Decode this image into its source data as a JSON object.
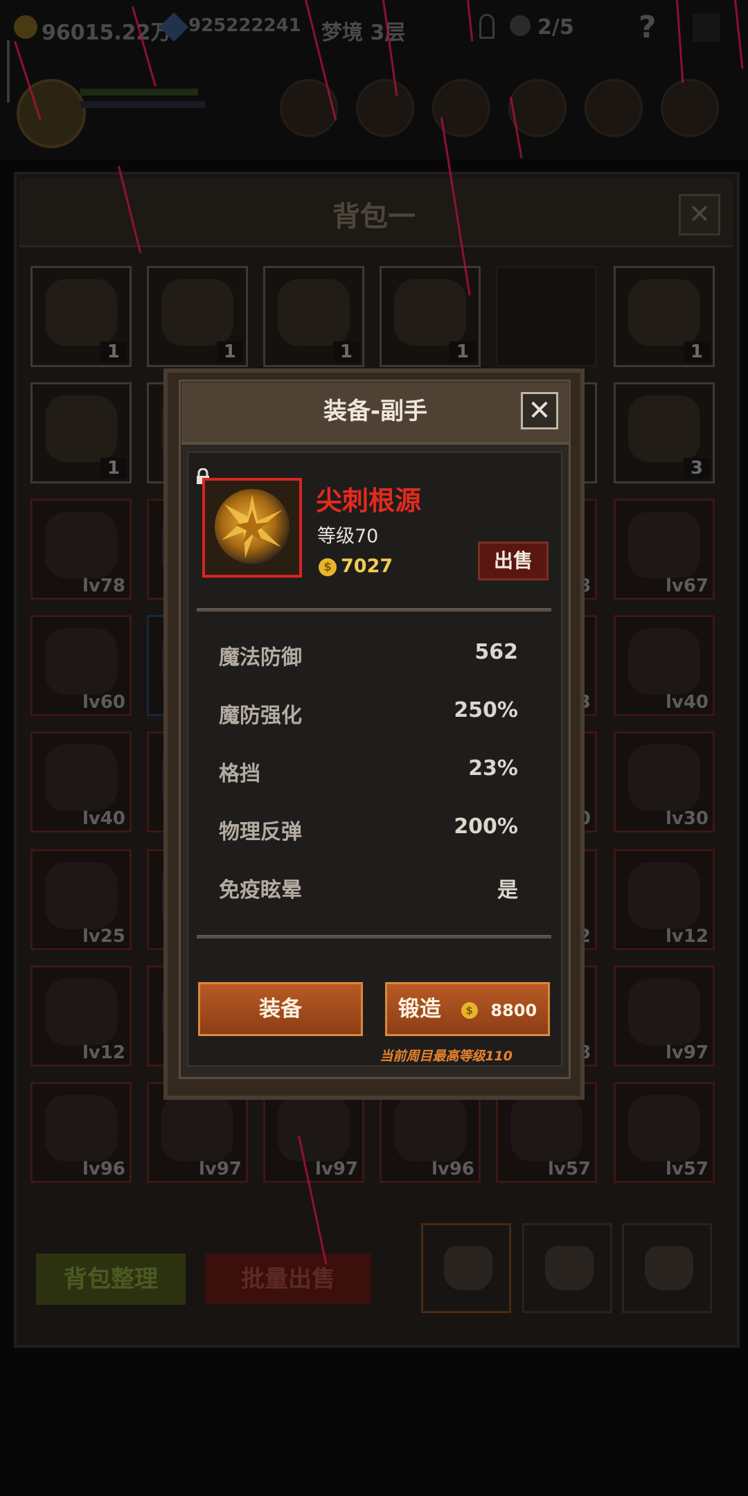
{
  "hud": {
    "gold": "96015.22万",
    "gems": "925222241",
    "dream_level": "梦境 3层",
    "key_progress": "2/5",
    "help": "?"
  },
  "bag": {
    "title": "背包一",
    "close": "✕",
    "rows": [
      [
        {
          "type": "item",
          "count": "1",
          "icon": "cake-icon"
        },
        {
          "type": "item",
          "count": "1",
          "icon": "cake-icon"
        },
        {
          "type": "item",
          "count": "1",
          "icon": "beer-mug-icon"
        },
        {
          "type": "item",
          "count": "1",
          "icon": "beer-mug-icon"
        },
        {
          "type": "empty"
        },
        {
          "type": "item",
          "count": "1",
          "icon": "cheese-icon"
        }
      ],
      [
        {
          "type": "item",
          "count": "1",
          "icon": "cheese-icon"
        },
        {
          "type": "item",
          "count": "",
          "icon": "unknown-icon"
        },
        {
          "type": "hidden"
        },
        {
          "type": "hidden"
        },
        {
          "type": "item",
          "count": "",
          "icon": "unknown-icon"
        },
        {
          "type": "item",
          "count": "3",
          "icon": "potion-icon"
        }
      ],
      [
        {
          "type": "gear",
          "level": "lv78",
          "icon": "axe-icon"
        },
        {
          "type": "gear",
          "level": "",
          "icon": "unknown-icon"
        },
        {
          "type": "hidden"
        },
        {
          "type": "hidden"
        },
        {
          "type": "gear",
          "level": "8",
          "icon": "unknown-icon"
        },
        {
          "type": "gear",
          "level": "lv67",
          "icon": "purple-hood-icon"
        }
      ],
      [
        {
          "type": "gear",
          "level": "lv60",
          "icon": "emerald-ring-icon"
        },
        {
          "type": "gear",
          "level": "",
          "icon": "unknown-icon",
          "blue": true
        },
        {
          "type": "hidden"
        },
        {
          "type": "hidden"
        },
        {
          "type": "gear",
          "level": "3",
          "icon": "unknown-icon"
        },
        {
          "type": "gear",
          "level": "lv40",
          "icon": "trident-icon"
        }
      ],
      [
        {
          "type": "gear",
          "level": "lv40",
          "icon": "sapphire-ring-icon"
        },
        {
          "type": "gear",
          "level": "",
          "icon": "unknown-icon"
        },
        {
          "type": "hidden"
        },
        {
          "type": "hidden"
        },
        {
          "type": "gear",
          "level": "0",
          "icon": "unknown-icon"
        },
        {
          "type": "gear",
          "level": "lv30",
          "icon": "purple-hood-icon"
        }
      ],
      [
        {
          "type": "gear",
          "level": "lv25",
          "icon": "helmet-icon"
        },
        {
          "type": "gear",
          "level": "",
          "icon": "unknown-icon"
        },
        {
          "type": "hidden"
        },
        {
          "type": "hidden"
        },
        {
          "type": "gear",
          "level": "2",
          "icon": "unknown-icon"
        },
        {
          "type": "gear",
          "level": "lv12",
          "icon": "black-ring-icon"
        }
      ],
      [
        {
          "type": "gear",
          "level": "lv12",
          "icon": "black-ring-icon"
        },
        {
          "type": "gear",
          "level": "",
          "icon": "unknown-icon"
        },
        {
          "type": "hidden"
        },
        {
          "type": "hidden"
        },
        {
          "type": "gear",
          "level": "8",
          "icon": "unknown-icon"
        },
        {
          "type": "gear",
          "level": "lv97",
          "icon": "dark-orb-icon"
        }
      ],
      [
        {
          "type": "gear",
          "level": "lv96",
          "icon": "rifle-icon"
        },
        {
          "type": "gear",
          "level": "lv97",
          "icon": "jade-ring-icon"
        },
        {
          "type": "gear",
          "level": "lv97",
          "icon": "knight-helmet-icon"
        },
        {
          "type": "gear",
          "level": "lv96",
          "icon": "jade-ring-icon"
        },
        {
          "type": "gear",
          "level": "lv57",
          "icon": "golden-armor-icon"
        },
        {
          "type": "gear",
          "level": "lv57",
          "icon": "silver-armor-icon"
        }
      ]
    ],
    "organize_button": "背包整理",
    "bulk_sell_button": "批量出售"
  },
  "modal": {
    "title": "装备-副手",
    "close": "✕",
    "item": {
      "name": "尖刺根源",
      "level": "等级70",
      "price": "7027",
      "icon": "spiked-orb-icon",
      "name_color": "#e52a1f"
    },
    "sell_button": "出售",
    "stats": [
      {
        "label": "魔法防御",
        "value": "562"
      },
      {
        "label": "魔防强化",
        "value": "250%"
      },
      {
        "label": "格挡",
        "value": "23%"
      },
      {
        "label": "物理反弹",
        "value": "200%"
      },
      {
        "label": "免疫眩晕",
        "value": "是"
      }
    ],
    "equip_button": "装备",
    "forge_button": "锻造",
    "forge_cost": "8800",
    "max_level_note": "当前周目最高等级110",
    "coin_glyph": "$"
  }
}
